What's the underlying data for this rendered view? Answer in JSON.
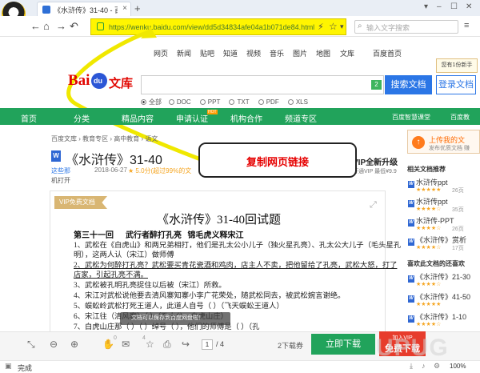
{
  "browser": {
    "tab_title": "《水浒传》31-40 - 百度文",
    "tab_close": "×",
    "new_tab": "+",
    "url": "https://wenku.baidu.com/view/dd5d34834afe04a1b071de84.html",
    "search_placeholder": "输入文字搜索",
    "window_controls": [
      "▾",
      "–",
      "☐",
      "✕"
    ],
    "status": "完成",
    "zoom": "100%"
  },
  "topnav": [
    "网页",
    "新闻",
    "贴吧",
    "知道",
    "视频",
    "音乐",
    "图片",
    "地图",
    "文库"
  ],
  "topnav_right": "百度首页",
  "logo": {
    "bai": "Bai",
    "du": "du",
    "wenku": "文库"
  },
  "search": {
    "badge": "2",
    "button": "搜索文档",
    "login": "登录文档"
  },
  "login_tip": "您有1份新手",
  "filters": [
    "全部",
    "DOC",
    "PPT",
    "TXT",
    "PDF",
    "XLS"
  ],
  "greenbar": [
    "首页",
    "分类",
    "精品内容",
    "申请认证",
    "机构合作",
    "频道专区"
  ],
  "greenbar_hot": "HOT",
  "greenbar_right": [
    "百度智慧课堂",
    "百度教"
  ],
  "breadcrumb": "百度文库 › 教育专区 › 高中教育 › 语文",
  "doc": {
    "icon": "W",
    "title": "《水浒传》31-40",
    "uploader": "这些那",
    "date": "2018-06-27",
    "rating": "★ 5.0分(超过99%的文",
    "vip_title": "VIP全新升级",
    "vip_sub": "开通VIP 最低¥9.9",
    "open_text": "机打开",
    "vip_flag": "VIP免费文档",
    "heading": "《水浒传》31-40回试题",
    "subheading": "第三十一回      武行者醉打孔亮   锦毛虎义释宋江",
    "lines": [
      "1、武松在《白虎山》和两兄弟相打，他们是孔太公小儿子（独火星孔亮）、孔太公大儿子（毛头星孔",
      "   明），这两人认（宋江）做师傅",
      "2、武松为何醉打孔亮？武松要买青花瓷酒和鸡肉，店主人不卖，把他留给了孔亮，武松大怒，打了",
      "   店家，引起孔亮不满。",
      "3、武松被孔明孔亮捉住以后被（宋江）所救。",
      "4、宋江对武松说他要去清风寨知寨小李广花荣处，随武松同去，被武松婉言谢绝。",
      "5、蜈蚣岭武松打死王道人，此道人自号（       ）（飞天蜈蚣王道人）",
      "6、宋江往（清风寨）（                                 ）（孔太公、白虎山庄）",
      "7、白虎山庄那（     ）（     ）绰号（     ），他们的师傅是（     ）（孔"
    ],
    "toast": "文档可以保存到百度网盘啦！"
  },
  "sidebar": {
    "upload_title": "上传我的文",
    "upload_sub": "发布优质文档 赚",
    "related_head": "相关文档推荐",
    "related": [
      {
        "title": "水浒传ppt",
        "stars": "★★★★★",
        "pages": "26页"
      },
      {
        "title": "水浒传ppt",
        "stars": "★★★★☆",
        "pages": "35页"
      },
      {
        "title": "水浒传-PPT",
        "stars": "★★★★☆",
        "pages": "26页"
      },
      {
        "title": "《水浒传》赏析",
        "stars": "★★★★☆",
        "pages": "17页"
      }
    ],
    "liked_head": "喜欢此文档的还喜欢",
    "liked": [
      {
        "title": "《水浒传》21-30",
        "stars": "★★★★☆"
      },
      {
        "title": "《水浒传》41-50",
        "stars": "★★★★★"
      },
      {
        "title": "《水浒传》1-10",
        "stars": "★★★★☆"
      }
    ]
  },
  "bottombar": {
    "like_count": "0",
    "comment_count": "4",
    "page_current": "1",
    "page_total": "/ 4",
    "download_count": "2下载券",
    "download_btn": "立即下载",
    "vip_btn_top": "加入VIP",
    "vip_btn_main": "免费下载",
    "watermark": "UPUG"
  },
  "callout": "复制网页链接",
  "colors": {
    "address_highlight": "#fff500",
    "green": "#21a35b",
    "blue": "#2b76e6",
    "callout_text": "#e60000"
  }
}
